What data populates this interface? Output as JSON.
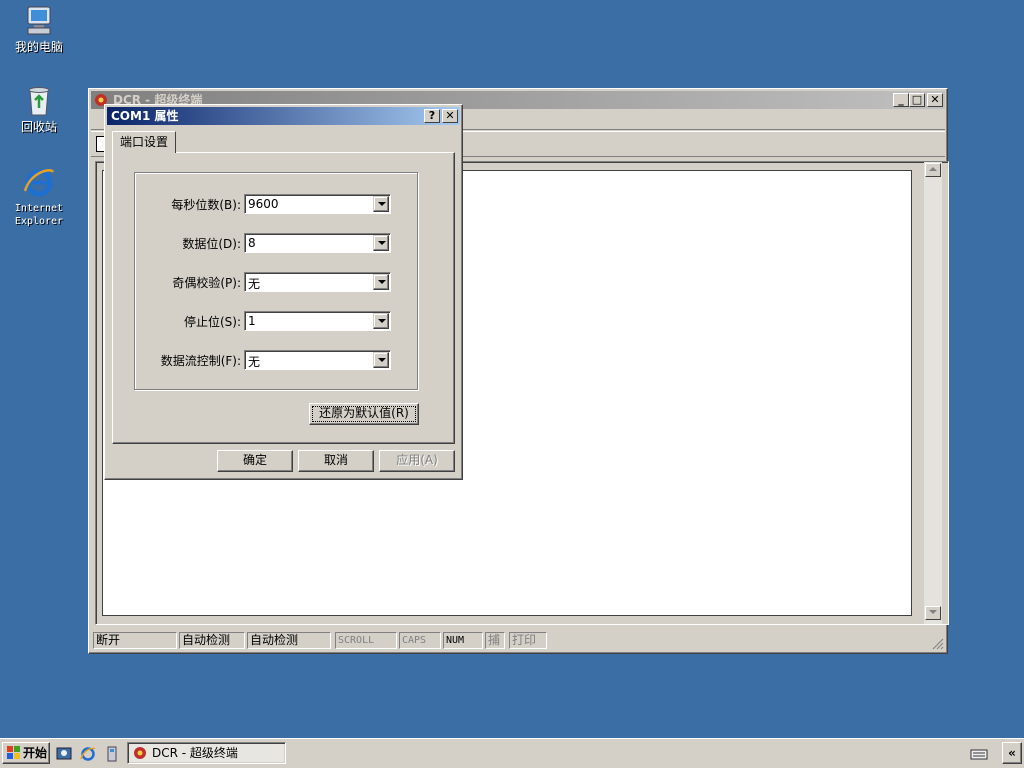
{
  "desktop": {
    "icons": [
      {
        "label": "我的电脑",
        "icon": "my-computer-icon"
      },
      {
        "label": "回收站",
        "icon": "recycle-bin-icon"
      },
      {
        "label": "Internet\nExplorer",
        "icon": "internet-explorer-icon"
      }
    ]
  },
  "main_window": {
    "title": "DCR - 超级终端",
    "status": [
      "断开",
      "自动检测",
      "自动检测",
      "SCROLL",
      "CAPS",
      "NUM",
      "捕",
      "打印"
    ]
  },
  "dialog": {
    "title": "COM1 属性",
    "tab": "端口设置",
    "fields": [
      {
        "label": "每秒位数(B):",
        "value": "9600"
      },
      {
        "label": "数据位(D):",
        "value": "8"
      },
      {
        "label": "奇偶校验(P):",
        "value": "无"
      },
      {
        "label": "停止位(S):",
        "value": "1"
      },
      {
        "label": "数据流控制(F):",
        "value": "无"
      }
    ],
    "restore_button": "还原为默认值(R)",
    "ok_button": "确定",
    "cancel_button": "取消",
    "apply_button": "应用(A)"
  },
  "taskbar": {
    "start_label": "开始",
    "task_label": "DCR - 超级终端",
    "tray_chevron": "«"
  },
  "colors": {
    "desktop": "#3a6ea5",
    "active_title": "#0a246a",
    "face": "#d4d0c8"
  }
}
